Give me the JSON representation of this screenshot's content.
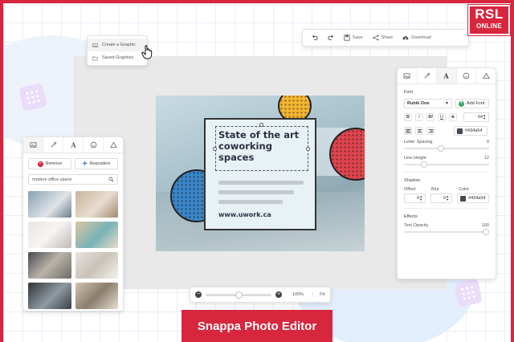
{
  "toolbar": {
    "undo_icon": "undo-icon",
    "redo_icon": "redo-icon",
    "save_label": "Save",
    "share_label": "Share",
    "download_label": "Download"
  },
  "menu": {
    "items": [
      {
        "label": "Create a Graphic",
        "icon": "image-icon"
      },
      {
        "label": "Saved Graphics",
        "icon": "folder-icon"
      }
    ]
  },
  "design": {
    "title": "State of the art coworking spaces",
    "url": "www.uwork.ca",
    "colors": {
      "yellow": "#f3b534",
      "red": "#e0454f",
      "blue": "#3b86c8",
      "ink": "#2d3142"
    }
  },
  "zoom": {
    "minus": "−",
    "plus": "+",
    "level_label": "100%",
    "level": 0.5,
    "fit_label": "Fit"
  },
  "left_panel": {
    "tabs": [
      "image-icon",
      "wand-icon",
      "text-icon",
      "emoji-icon",
      "shape-icon"
    ],
    "remove_label": "Remove",
    "reposition_label": "Reposition",
    "search_value": "modern office space"
  },
  "right_panel": {
    "tabs": [
      "image-icon",
      "wand-icon",
      "text-icon",
      "emoji-icon",
      "shape-icon"
    ],
    "font_heading": "Font",
    "font_name": "Rubik One",
    "add_font_label": "Add Font",
    "font_size": "64",
    "style_buttons": [
      "B",
      "I",
      "BI",
      "U",
      "S"
    ],
    "align_buttons": [
      "align-left-icon",
      "align-center-icon",
      "align-right-icon"
    ],
    "text_color": "#434a54",
    "letter_spacing_label": "Letter Spacing",
    "letter_spacing_value": "0",
    "line_height_label": "Line Height",
    "line_height_value": "12",
    "shadow_heading": "Shadow",
    "offset_label": "Offset",
    "offset_value": "0",
    "blur_label": "Blur",
    "blur_value": "0",
    "color_label": "Color",
    "shadow_color": "#434a54",
    "effects_heading": "Effects",
    "text_opacity_label": "Text Opacity",
    "text_opacity_value": "100"
  },
  "logo": {
    "line1": "RSL",
    "line2": "ONLINE"
  },
  "caption": "Snappa Photo Editor",
  "accent": "#d7263d"
}
